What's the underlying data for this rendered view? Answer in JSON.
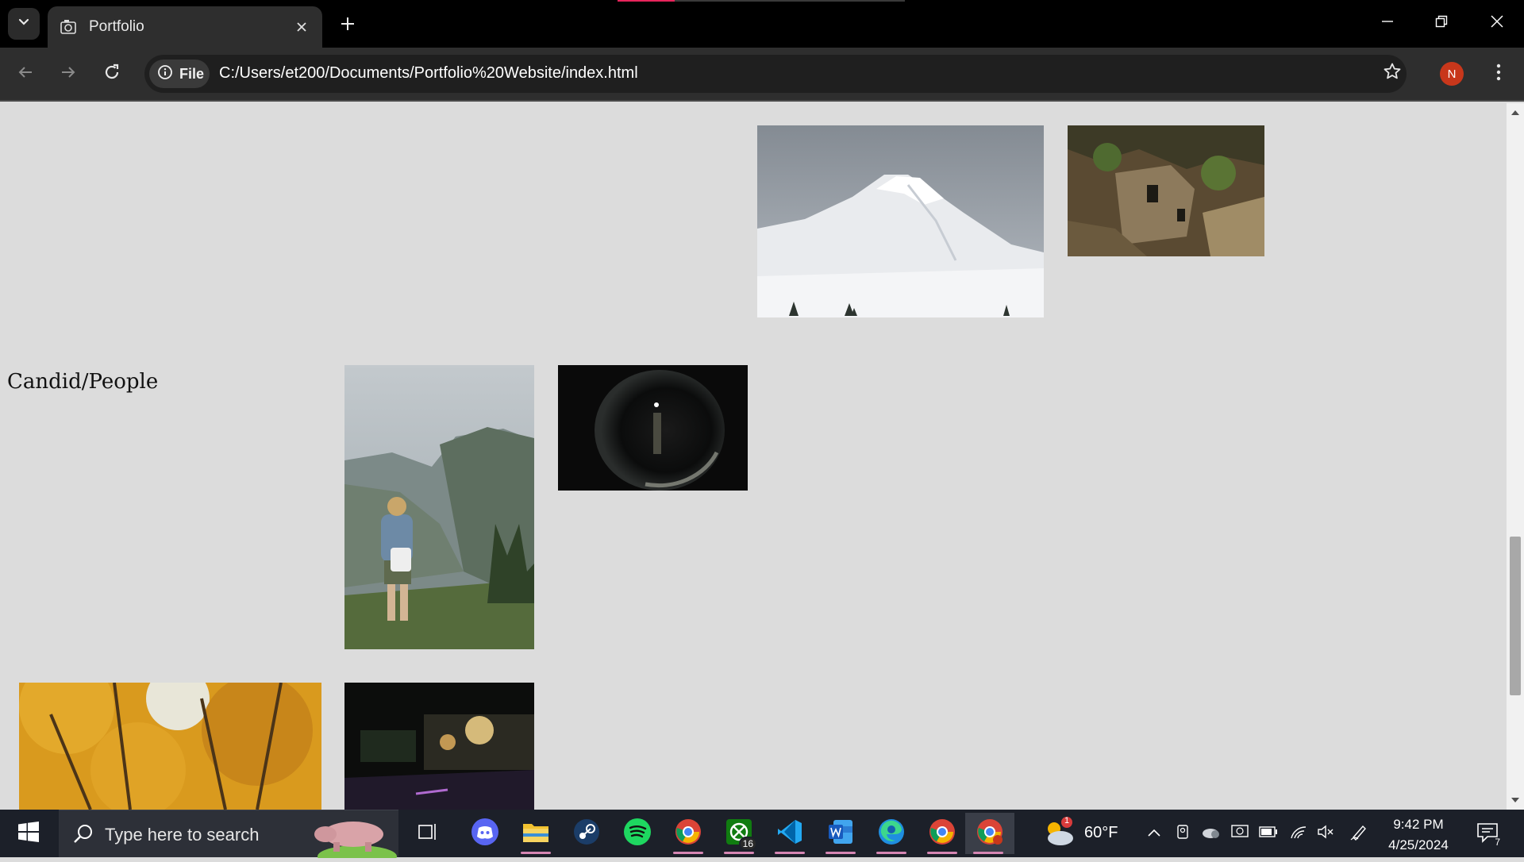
{
  "browser": {
    "tab": {
      "title": "Portfolio"
    },
    "address": {
      "scheme_label": "File",
      "url": "C:/Users/et200/Documents/Portfolio%20Website/index.html"
    },
    "profile_initial": "N"
  },
  "page": {
    "sections": [
      {
        "heading": "Candid/People"
      }
    ],
    "photos": [
      {
        "subject": "snow-capped mountain"
      },
      {
        "subject": "stone house in cliff"
      },
      {
        "subject": "hiker overlooking valley"
      },
      {
        "subject": "figure in dark tunnel"
      },
      {
        "subject": "autumn trees"
      },
      {
        "subject": "night street"
      }
    ]
  },
  "taskbar": {
    "search_placeholder": "Type here to search",
    "apps": [
      {
        "name": "task-view",
        "icon": "task-view-icon"
      },
      {
        "name": "discord",
        "icon": "discord-icon"
      },
      {
        "name": "file-explorer",
        "icon": "folder-icon",
        "running": true
      },
      {
        "name": "steam",
        "icon": "steam-icon"
      },
      {
        "name": "spotify",
        "icon": "spotify-icon"
      },
      {
        "name": "chrome",
        "icon": "chrome-icon",
        "running": true
      },
      {
        "name": "xbox",
        "icon": "xbox-icon",
        "badge": "16",
        "running": true
      },
      {
        "name": "vscode",
        "icon": "vscode-icon",
        "running": true
      },
      {
        "name": "word",
        "icon": "word-icon",
        "running": true
      },
      {
        "name": "edge",
        "icon": "edge-icon",
        "running": true
      },
      {
        "name": "chrome-2",
        "icon": "chrome-icon",
        "running": true
      },
      {
        "name": "chrome-profile-n",
        "icon": "chrome-icon",
        "running": true,
        "active": true
      }
    ],
    "weather": {
      "temp": "60°F",
      "alert_count": "1"
    },
    "clock": {
      "time": "9:42 PM",
      "date": "4/25/2024"
    },
    "notification_count": "7"
  },
  "colors": {
    "page_bg": "#dcdcdc",
    "titlebar_bg": "#000000",
    "toolbar_bg": "#2e2e2e",
    "taskbar_bg": "#1c2029",
    "accent": "#e8245b",
    "avatar": "#c8371b"
  }
}
